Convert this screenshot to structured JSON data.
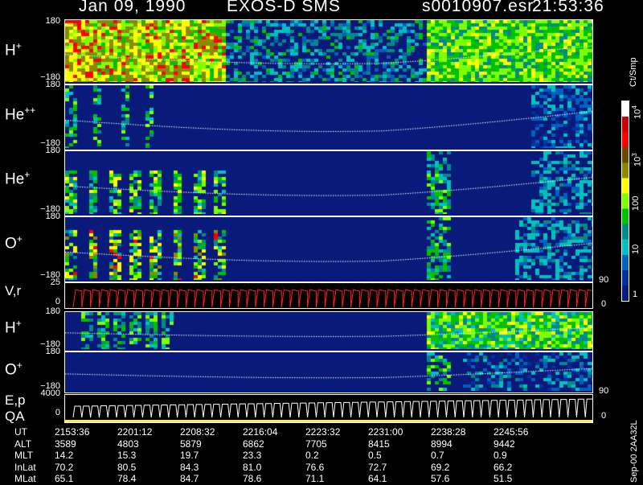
{
  "header": {
    "date": "Jan 09, 1990",
    "instrument": "EXOS-D SMS",
    "file": "s0010907.esr",
    "time": "21:53:36"
  },
  "panels": [
    {
      "id": "h_plus_top",
      "label": "H",
      "sup": "+",
      "ymax": "180",
      "ymin": "−180"
    },
    {
      "id": "he_pp",
      "label": "He",
      "sup": "++",
      "ymax": "180",
      "ymin": "−180"
    },
    {
      "id": "he_p",
      "label": "He",
      "sup": "+",
      "ymax": "180",
      "ymin": "−180"
    },
    {
      "id": "o_plus",
      "label": "O",
      "sup": "+",
      "ymax": "180",
      "ymin": "−180",
      "right_tick": "90"
    },
    {
      "id": "v_r",
      "label": "V,r",
      "ymax": "25",
      "ymin": "0",
      "right_tick": "0"
    },
    {
      "id": "h_plus_bot",
      "label": "H",
      "sup": "+",
      "ymax": "180",
      "ymin": "−180"
    },
    {
      "id": "o_plus_bot",
      "label": "O",
      "sup": "+",
      "ymax": "180",
      "ymin": "−180",
      "right_tick": "90"
    },
    {
      "id": "ep_qa",
      "label": "E,p",
      "label2": "QA",
      "ymax": "4000",
      "ymin": "0",
      "right_tick": "0"
    }
  ],
  "colorbar": {
    "units": "Ct/Smp",
    "ticks": [
      "10",
      "4",
      "10",
      "3",
      "100",
      "10",
      "1"
    ],
    "colors": [
      "#ffffff",
      "#c80000",
      "#ff0000",
      "#6b4a00",
      "#8a8a00",
      "#ffff00",
      "#80ff00",
      "#00c000",
      "#008a8a",
      "#00c0c0",
      "#0060c0",
      "#0030a0",
      "#0a1a7a"
    ]
  },
  "ephemeris": {
    "rows": [
      {
        "name": "UT",
        "values": [
          "2153:36",
          "2201:12",
          "2208:32",
          "2216:04",
          "2223:32",
          "2231:00",
          "2238:28",
          "2245:56"
        ]
      },
      {
        "name": "ALT",
        "values": [
          "3589",
          "4803",
          "5879",
          "6862",
          "7705",
          "8415",
          "8994",
          "9442"
        ]
      },
      {
        "name": "MLT",
        "values": [
          "14.2",
          "15.3",
          "19.7",
          "23.3",
          "0.2",
          "0.5",
          "0.7",
          "0.9"
        ]
      },
      {
        "name": "InLat",
        "values": [
          "70.2",
          "80.5",
          "84.3",
          "81.0",
          "76.6",
          "72.7",
          "69.2",
          "66.2"
        ]
      },
      {
        "name": "MLat",
        "values": [
          "65.1",
          "78.4",
          "84.7",
          "78.6",
          "71.1",
          "64.1",
          "57.6",
          "51.5"
        ]
      }
    ]
  },
  "side_note": "Sep-00  2AA32L",
  "chart_data": {
    "type": "heatmap",
    "title": "Jan 09, 1990   EXOS-D SMS",
    "xlabel": "UT",
    "x": [
      "2153:36",
      "2201:12",
      "2208:32",
      "2216:04",
      "2223:32",
      "2231:00",
      "2238:28",
      "2245:56"
    ],
    "series": [
      {
        "name": "H+",
        "ylim": [
          -180,
          180
        ]
      },
      {
        "name": "He++",
        "ylim": [
          -180,
          180
        ]
      },
      {
        "name": "He+",
        "ylim": [
          -180,
          180
        ]
      },
      {
        "name": "O+",
        "ylim": [
          -180,
          180
        ]
      },
      {
        "name": "V,r",
        "ylim": [
          0,
          25
        ]
      },
      {
        "name": "H+",
        "ylim": [
          -180,
          180
        ]
      },
      {
        "name": "O+",
        "ylim": [
          -180,
          180
        ]
      },
      {
        "name": "E,p",
        "ylim": [
          0,
          4000
        ]
      }
    ],
    "colorbar_scale": "log",
    "colorbar_range": [
      1,
      10000
    ]
  }
}
